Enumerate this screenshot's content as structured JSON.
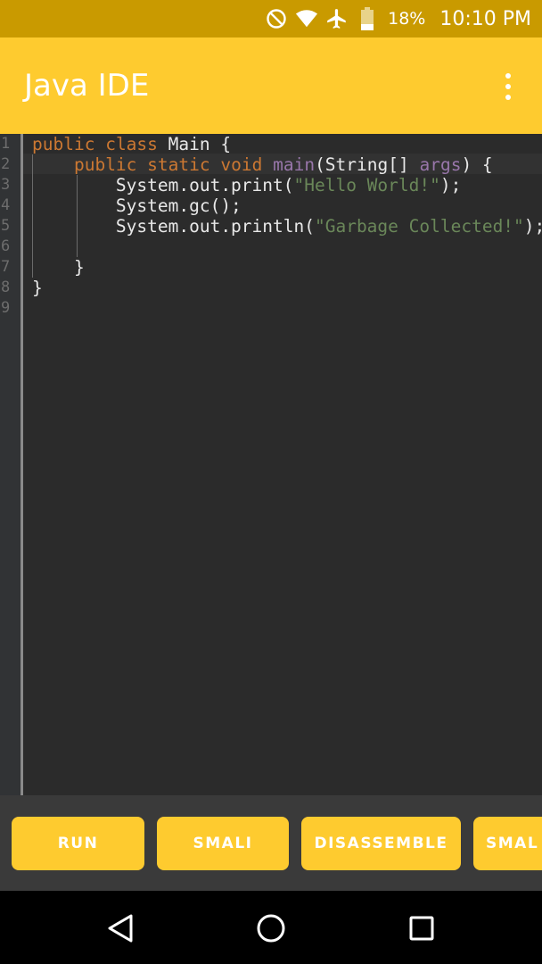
{
  "status_bar": {
    "icons": [
      "do-not-disturb-icon",
      "wifi-icon",
      "airplane-mode-icon",
      "battery-icon"
    ],
    "battery_percent": "18%",
    "time": "10:10 PM"
  },
  "app_bar": {
    "title": "Java IDE",
    "overflow_icon": "more-vert-icon"
  },
  "editor": {
    "line_numbers": [
      "1",
      "2",
      "3",
      "4",
      "5",
      "6",
      "7",
      "8",
      "9"
    ],
    "lines": [
      "public class Main {",
      "    public static void main(String[] args) {",
      "        System.out.print(\"Hello World!\");",
      "        System.gc();",
      "        System.out.println(\"Garbage Collected!\");",
      "",
      "    }",
      "}",
      ""
    ],
    "colors": {
      "keyword": "#cc7832",
      "method": "#9876aa",
      "string": "#6a8759",
      "text": "#e8e8e8"
    }
  },
  "buttons": {
    "run": "RUN",
    "smali": "SMALI",
    "disassemble": "DISASSEMBLE",
    "smali_partial": "SMAL"
  },
  "nav_bar": {
    "back_icon": "back-triangle-icon",
    "home_icon": "home-circle-icon",
    "recents_icon": "recents-square-icon"
  },
  "theme": {
    "accent": "#fecb2f",
    "status_bar": "#c99a00",
    "editor_bg": "#2b2b2b"
  }
}
